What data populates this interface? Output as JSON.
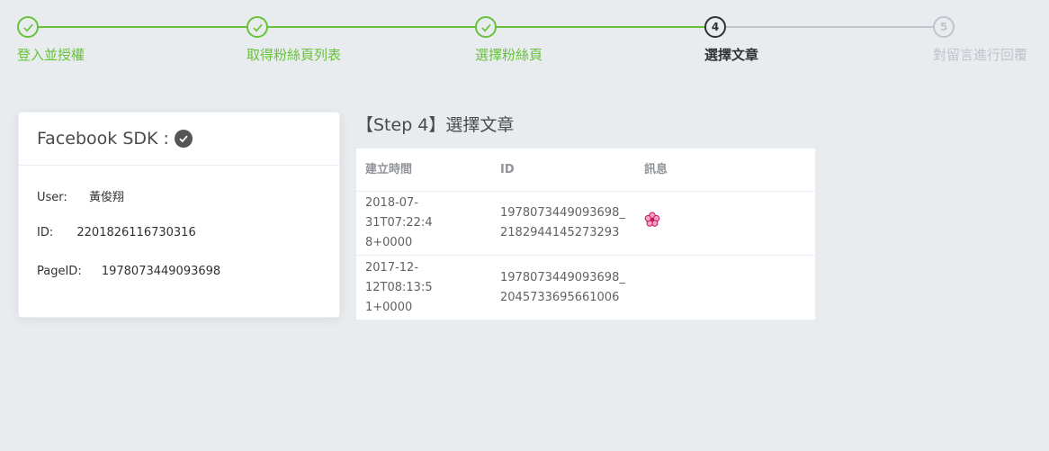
{
  "steps": [
    {
      "number": "1",
      "title": "登入並授權",
      "status": "done"
    },
    {
      "number": "2",
      "title": "取得粉絲頁列表",
      "status": "done"
    },
    {
      "number": "3",
      "title": "選擇粉絲頁",
      "status": "done"
    },
    {
      "number": "4",
      "title": "選擇文章",
      "status": "current"
    },
    {
      "number": "5",
      "title": "對留言進行回覆",
      "status": "wait"
    }
  ],
  "card": {
    "title": "Facebook SDK :",
    "user_label": "User:",
    "user_value": "黃俊翔",
    "id_label": "ID:",
    "id_value": "2201826116730316",
    "page_id_label": "PageID:",
    "page_id_value": "1978073449093698"
  },
  "panel": {
    "title": "【Step 4】選擇文章",
    "columns": [
      "建立時間",
      "ID",
      "訊息"
    ],
    "rows": [
      {
        "time": "2018-07-31T07:22:4\n8+0000",
        "id": "1978073449093698_\n2182944145273293",
        "message_icon": "cherry-blossom-icon"
      },
      {
        "time": "2017-12-12T08:13:5\n1+0000",
        "id": "1978073449093698_\n2045733695661006",
        "message_icon": ""
      }
    ]
  },
  "colors": {
    "success": "#67c23a",
    "current": "#303133",
    "wait": "#c0c4cc",
    "background": "#e9ecef"
  }
}
